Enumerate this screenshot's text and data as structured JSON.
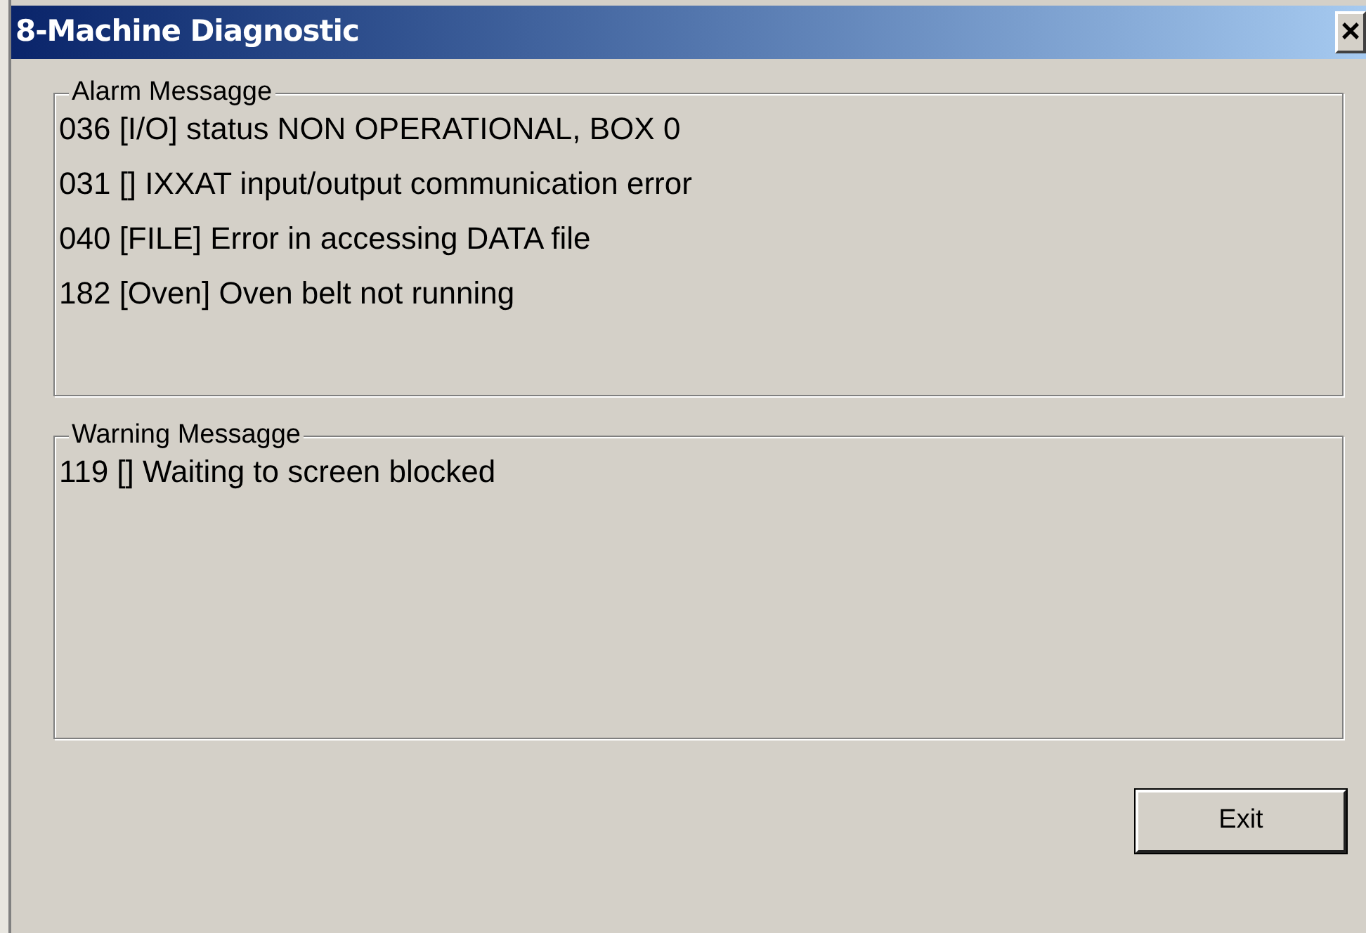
{
  "window": {
    "title": "8-Machine Diagnostic",
    "close": "×"
  },
  "groups": [
    {
      "title": "Alarm Messagge",
      "messages": [
        "036 [I/O] status NON OPERATIONAL, BOX 0",
        "031 [] IXXAT input/output communication error",
        "040 [FILE] Error in accessing DATA file",
        "182 [Oven] Oven belt not running"
      ]
    },
    {
      "title": "Warning Messagge",
      "messages": [
        "119 [] Waiting to screen blocked"
      ]
    }
  ],
  "buttons": [
    "Exit"
  ]
}
